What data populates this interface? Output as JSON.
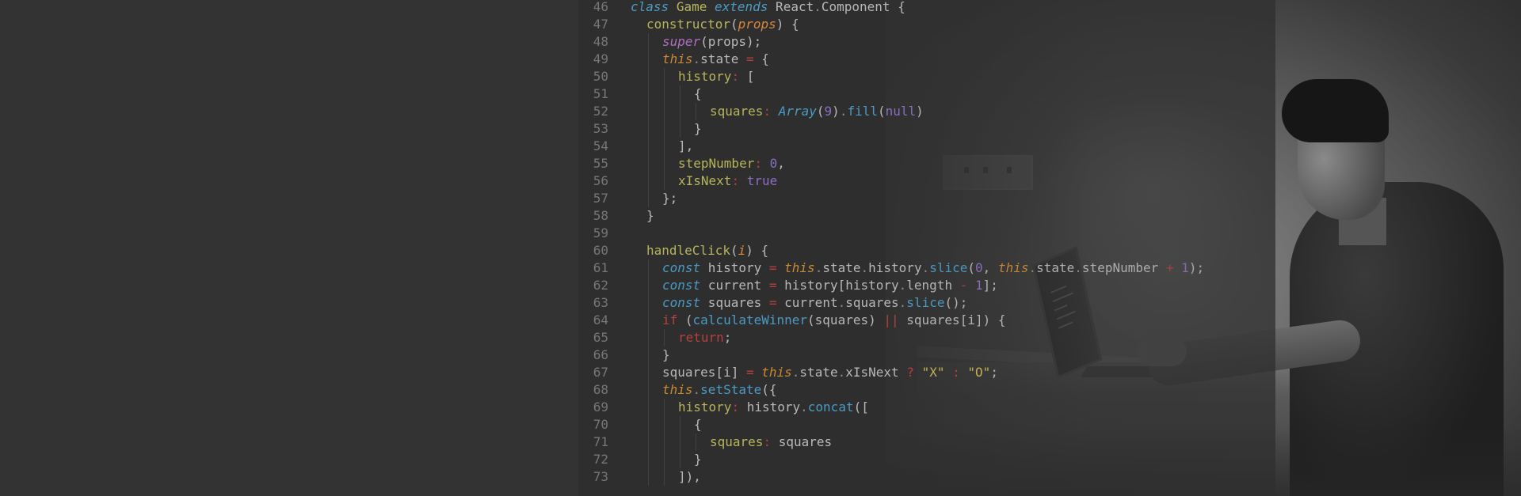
{
  "editor": {
    "lines": [
      {
        "n": "46",
        "indent": 0,
        "tokens": [
          {
            "c": "t-kw-italic",
            "t": "class"
          },
          {
            "c": "t-def",
            "t": " "
          },
          {
            "c": "t-cls",
            "t": "Game"
          },
          {
            "c": "t-def",
            "t": " "
          },
          {
            "c": "t-kw-italic",
            "t": "extends"
          },
          {
            "c": "t-def",
            "t": " React"
          },
          {
            "c": "t-dot",
            "t": "."
          },
          {
            "c": "t-def",
            "t": "Component {"
          }
        ]
      },
      {
        "n": "47",
        "indent": 1,
        "tokens": [
          {
            "c": "t-fn",
            "t": "constructor"
          },
          {
            "c": "t-punc",
            "t": "("
          },
          {
            "c": "t-param",
            "t": "props"
          },
          {
            "c": "t-punc",
            "t": ") {"
          }
        ]
      },
      {
        "n": "48",
        "indent": 2,
        "tokens": [
          {
            "c": "t-super",
            "t": "super"
          },
          {
            "c": "t-punc",
            "t": "(props);"
          }
        ]
      },
      {
        "n": "49",
        "indent": 2,
        "tokens": [
          {
            "c": "t-this",
            "t": "this"
          },
          {
            "c": "t-dot",
            "t": "."
          },
          {
            "c": "t-def",
            "t": "state "
          },
          {
            "c": "t-op",
            "t": "="
          },
          {
            "c": "t-punc",
            "t": " {"
          }
        ]
      },
      {
        "n": "50",
        "indent": 3,
        "tokens": [
          {
            "c": "t-prop",
            "t": "history"
          },
          {
            "c": "t-op",
            "t": ":"
          },
          {
            "c": "t-punc",
            "t": " ["
          }
        ]
      },
      {
        "n": "51",
        "indent": 4,
        "tokens": [
          {
            "c": "t-punc",
            "t": "{"
          }
        ]
      },
      {
        "n": "52",
        "indent": 5,
        "tokens": [
          {
            "c": "t-prop",
            "t": "squares"
          },
          {
            "c": "t-op",
            "t": ":"
          },
          {
            "c": "t-def",
            "t": " "
          },
          {
            "c": "t-array",
            "t": "Array"
          },
          {
            "c": "t-punc",
            "t": "("
          },
          {
            "c": "t-num",
            "t": "9"
          },
          {
            "c": "t-punc",
            "t": ")"
          },
          {
            "c": "t-dot",
            "t": "."
          },
          {
            "c": "t-method",
            "t": "fill"
          },
          {
            "c": "t-punc",
            "t": "("
          },
          {
            "c": "t-null",
            "t": "null"
          },
          {
            "c": "t-punc",
            "t": ")"
          }
        ]
      },
      {
        "n": "53",
        "indent": 4,
        "tokens": [
          {
            "c": "t-punc",
            "t": "}"
          }
        ]
      },
      {
        "n": "54",
        "indent": 3,
        "tokens": [
          {
            "c": "t-punc",
            "t": "],"
          }
        ]
      },
      {
        "n": "55",
        "indent": 3,
        "tokens": [
          {
            "c": "t-prop",
            "t": "stepNumber"
          },
          {
            "c": "t-op",
            "t": ":"
          },
          {
            "c": "t-def",
            "t": " "
          },
          {
            "c": "t-num",
            "t": "0"
          },
          {
            "c": "t-punc",
            "t": ","
          }
        ]
      },
      {
        "n": "56",
        "indent": 3,
        "tokens": [
          {
            "c": "t-prop",
            "t": "xIsNext"
          },
          {
            "c": "t-op",
            "t": ":"
          },
          {
            "c": "t-def",
            "t": " "
          },
          {
            "c": "t-bool",
            "t": "true"
          }
        ]
      },
      {
        "n": "57",
        "indent": 2,
        "tokens": [
          {
            "c": "t-punc",
            "t": "};"
          }
        ]
      },
      {
        "n": "58",
        "indent": 1,
        "tokens": [
          {
            "c": "t-punc",
            "t": "}"
          }
        ]
      },
      {
        "n": "59",
        "indent": 0,
        "tokens": []
      },
      {
        "n": "60",
        "indent": 1,
        "tokens": [
          {
            "c": "t-fn",
            "t": "handleClick"
          },
          {
            "c": "t-punc",
            "t": "("
          },
          {
            "c": "t-param",
            "t": "i"
          },
          {
            "c": "t-punc",
            "t": ") {"
          }
        ]
      },
      {
        "n": "61",
        "indent": 2,
        "tokens": [
          {
            "c": "t-kw-italic",
            "t": "const"
          },
          {
            "c": "t-def",
            "t": " history "
          },
          {
            "c": "t-op",
            "t": "="
          },
          {
            "c": "t-def",
            "t": " "
          },
          {
            "c": "t-this",
            "t": "this"
          },
          {
            "c": "t-dot",
            "t": "."
          },
          {
            "c": "t-def",
            "t": "state"
          },
          {
            "c": "t-dot",
            "t": "."
          },
          {
            "c": "t-def",
            "t": "history"
          },
          {
            "c": "t-dot",
            "t": "."
          },
          {
            "c": "t-method",
            "t": "slice"
          },
          {
            "c": "t-punc",
            "t": "("
          },
          {
            "c": "t-num",
            "t": "0"
          },
          {
            "c": "t-punc",
            "t": ", "
          },
          {
            "c": "t-this",
            "t": "this"
          },
          {
            "c": "t-dot",
            "t": "."
          },
          {
            "c": "t-def",
            "t": "state"
          },
          {
            "c": "t-dot",
            "t": "."
          },
          {
            "c": "t-def",
            "t": "stepNumber "
          },
          {
            "c": "t-op",
            "t": "+"
          },
          {
            "c": "t-def",
            "t": " "
          },
          {
            "c": "t-num",
            "t": "1"
          },
          {
            "c": "t-punc",
            "t": ");"
          }
        ]
      },
      {
        "n": "62",
        "indent": 2,
        "tokens": [
          {
            "c": "t-kw-italic",
            "t": "const"
          },
          {
            "c": "t-def",
            "t": " current "
          },
          {
            "c": "t-op",
            "t": "="
          },
          {
            "c": "t-def",
            "t": " history[history"
          },
          {
            "c": "t-dot",
            "t": "."
          },
          {
            "c": "t-def",
            "t": "length "
          },
          {
            "c": "t-op",
            "t": "-"
          },
          {
            "c": "t-def",
            "t": " "
          },
          {
            "c": "t-num",
            "t": "1"
          },
          {
            "c": "t-punc",
            "t": "];"
          }
        ]
      },
      {
        "n": "63",
        "indent": 2,
        "tokens": [
          {
            "c": "t-kw-italic",
            "t": "const"
          },
          {
            "c": "t-def",
            "t": " squares "
          },
          {
            "c": "t-op",
            "t": "="
          },
          {
            "c": "t-def",
            "t": " current"
          },
          {
            "c": "t-dot",
            "t": "."
          },
          {
            "c": "t-def",
            "t": "squares"
          },
          {
            "c": "t-dot",
            "t": "."
          },
          {
            "c": "t-method",
            "t": "slice"
          },
          {
            "c": "t-punc",
            "t": "();"
          }
        ]
      },
      {
        "n": "64",
        "indent": 2,
        "tokens": [
          {
            "c": "t-ctrl",
            "t": "if"
          },
          {
            "c": "t-punc",
            "t": " ("
          },
          {
            "c": "t-call",
            "t": "calculateWinner"
          },
          {
            "c": "t-punc",
            "t": "(squares) "
          },
          {
            "c": "t-op",
            "t": "||"
          },
          {
            "c": "t-def",
            "t": " squares[i]) {"
          }
        ]
      },
      {
        "n": "65",
        "indent": 3,
        "tokens": [
          {
            "c": "t-ctrl",
            "t": "return"
          },
          {
            "c": "t-punc",
            "t": ";"
          }
        ]
      },
      {
        "n": "66",
        "indent": 2,
        "tokens": [
          {
            "c": "t-punc",
            "t": "}"
          }
        ]
      },
      {
        "n": "67",
        "indent": 2,
        "tokens": [
          {
            "c": "t-def",
            "t": "squares[i] "
          },
          {
            "c": "t-op",
            "t": "="
          },
          {
            "c": "t-def",
            "t": " "
          },
          {
            "c": "t-this",
            "t": "this"
          },
          {
            "c": "t-dot",
            "t": "."
          },
          {
            "c": "t-def",
            "t": "state"
          },
          {
            "c": "t-dot",
            "t": "."
          },
          {
            "c": "t-def",
            "t": "xIsNext "
          },
          {
            "c": "t-op",
            "t": "?"
          },
          {
            "c": "t-def",
            "t": " "
          },
          {
            "c": "t-str",
            "t": "\"X\""
          },
          {
            "c": "t-def",
            "t": " "
          },
          {
            "c": "t-op",
            "t": ":"
          },
          {
            "c": "t-def",
            "t": " "
          },
          {
            "c": "t-str",
            "t": "\"O\""
          },
          {
            "c": "t-punc",
            "t": ";"
          }
        ]
      },
      {
        "n": "68",
        "indent": 2,
        "tokens": [
          {
            "c": "t-this",
            "t": "this"
          },
          {
            "c": "t-dot",
            "t": "."
          },
          {
            "c": "t-method",
            "t": "setState"
          },
          {
            "c": "t-punc",
            "t": "({"
          }
        ]
      },
      {
        "n": "69",
        "indent": 3,
        "tokens": [
          {
            "c": "t-prop",
            "t": "history"
          },
          {
            "c": "t-op",
            "t": ":"
          },
          {
            "c": "t-def",
            "t": " history"
          },
          {
            "c": "t-dot",
            "t": "."
          },
          {
            "c": "t-method",
            "t": "concat"
          },
          {
            "c": "t-punc",
            "t": "(["
          }
        ]
      },
      {
        "n": "70",
        "indent": 4,
        "tokens": [
          {
            "c": "t-punc",
            "t": "{"
          }
        ]
      },
      {
        "n": "71",
        "indent": 5,
        "tokens": [
          {
            "c": "t-prop",
            "t": "squares"
          },
          {
            "c": "t-op",
            "t": ":"
          },
          {
            "c": "t-def",
            "t": " squares"
          }
        ]
      },
      {
        "n": "72",
        "indent": 4,
        "tokens": [
          {
            "c": "t-punc",
            "t": "}"
          }
        ]
      },
      {
        "n": "73",
        "indent": 3,
        "tokens": [
          {
            "c": "t-punc",
            "t": "]),"
          }
        ]
      }
    ]
  },
  "colors": {
    "background": "#333333",
    "editor_panel": "#2d2d2d",
    "line_number": "#777777",
    "keyword": "#4a9bc4",
    "class_name": "#b7b55b",
    "this_keyword": "#c98a34",
    "operator": "#b4413f",
    "number": "#8a6fc0"
  },
  "photo": {
    "icon": "person-at-laptop-photo"
  }
}
